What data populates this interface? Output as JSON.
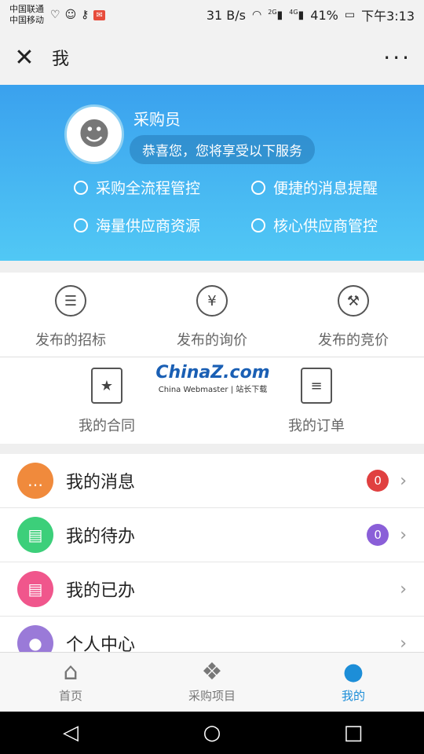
{
  "status_bar": {
    "carrier_1": "中国联通",
    "carrier_2": "中国移动",
    "speed": "31 B/s",
    "signal_1": "2G",
    "signal_2": "4G",
    "battery": "41%",
    "time": "下午3:13"
  },
  "header": {
    "title": "我"
  },
  "profile": {
    "role": "采购员",
    "welcome": "恭喜您，您将享受以下服务",
    "features": [
      "采购全流程管控",
      "便捷的消息提醒",
      "海量供应商资源",
      "核心供应商管控"
    ]
  },
  "actions": {
    "row1": [
      {
        "label": "发布的招标",
        "icon": "tender-list-icon"
      },
      {
        "label": "发布的询价",
        "icon": "yen-icon"
      },
      {
        "label": "发布的竞价",
        "icon": "gavel-icon"
      }
    ],
    "contract": {
      "label": "我的合同",
      "icon": "contract-icon"
    },
    "order": {
      "label": "我的订单",
      "icon": "clipboard-icon"
    }
  },
  "watermark": {
    "logo": "ChinaZ.com",
    "sub": "China Webmaster | 站长下载"
  },
  "list": [
    {
      "label": "我的消息",
      "count": "0",
      "icon_color": "#f08a3c",
      "badge_color": "#e04040"
    },
    {
      "label": "我的待办",
      "count": "0",
      "icon_color": "#3ccf7a",
      "badge_color": "#8a5fd8"
    },
    {
      "label": "我的已办",
      "icon_color": "#f0568c"
    },
    {
      "label": "个人中心",
      "icon_color": "#9a7ad8"
    }
  ],
  "tabs": [
    "首页",
    "采购项目",
    "我的"
  ],
  "colors": {
    "accent": "#1d8ed8",
    "hero_top": "#3aa1ee",
    "hero_bottom": "#51c8f5"
  }
}
